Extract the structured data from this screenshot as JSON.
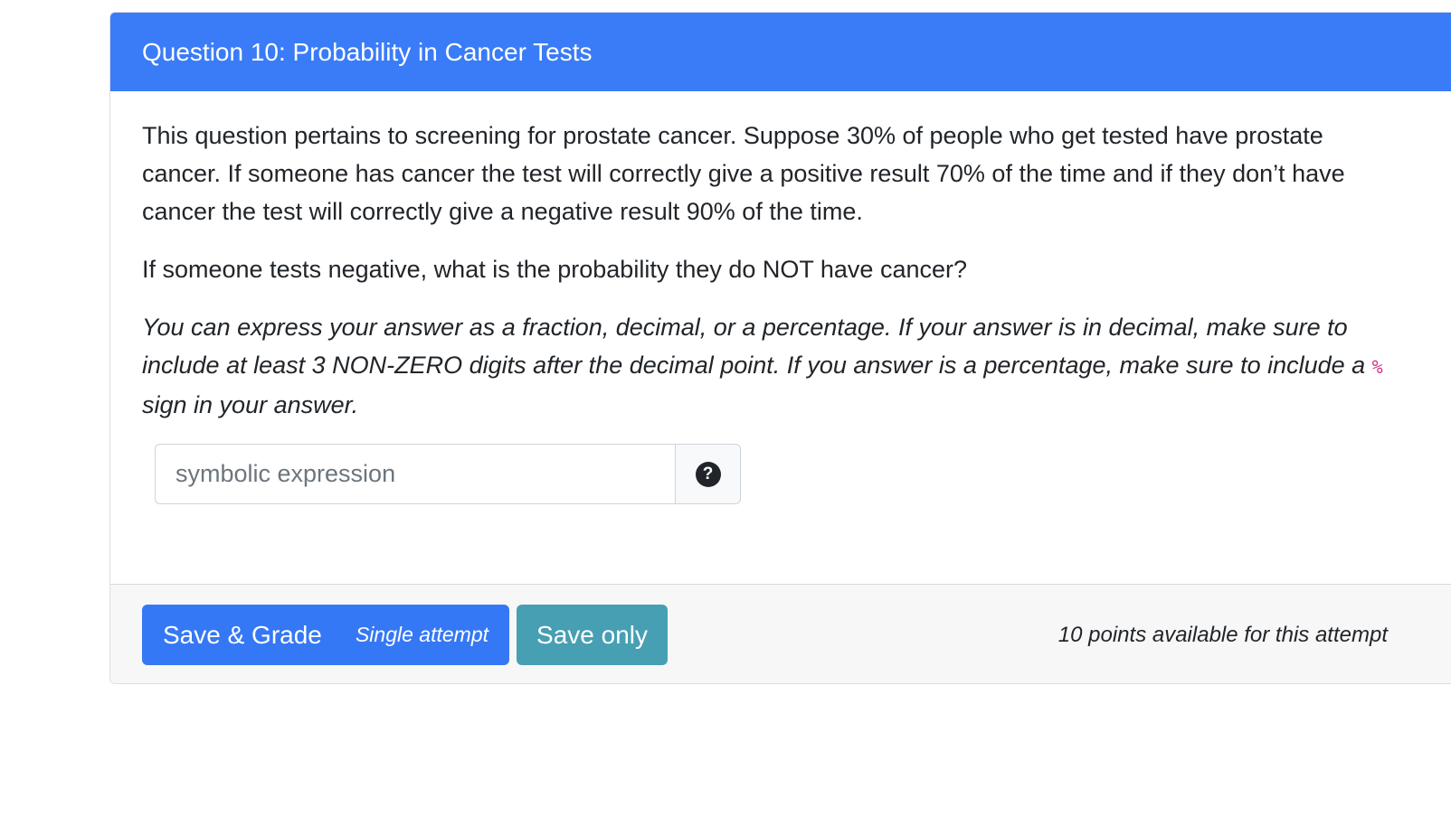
{
  "question": {
    "title": "Question 10: Probability in Cancer Tests",
    "paragraph1": "This question pertains to screening for prostate cancer. Suppose 30% of people who get tested have prostate cancer. If someone has cancer the test will correctly give a positive result 70% of the time and if they don’t have cancer the test will correctly give a negative result 90% of the time.",
    "paragraph2": "If someone tests negative, what is the probability they do NOT have cancer?",
    "instructions_before": "You can express your answer as a fraction, decimal, or a percentage. If your answer is in decimal, make sure to include at least 3 NON-ZERO digits after the decimal point. If you answer is a percentage, make sure to include a ",
    "instructions_code": "%",
    "instructions_after": " sign in your answer."
  },
  "answer": {
    "value": "",
    "placeholder": "symbolic expression",
    "help_icon": "?"
  },
  "footer": {
    "grade_label": "Save & Grade",
    "grade_sublabel": "Single attempt",
    "save_label": "Save only",
    "points_text": "10 points available for this attempt"
  },
  "colors": {
    "header_bg": "#3a7cf7",
    "grade_button": "#3578f5",
    "save_button": "#479fb3",
    "code_text": "#d63384"
  }
}
